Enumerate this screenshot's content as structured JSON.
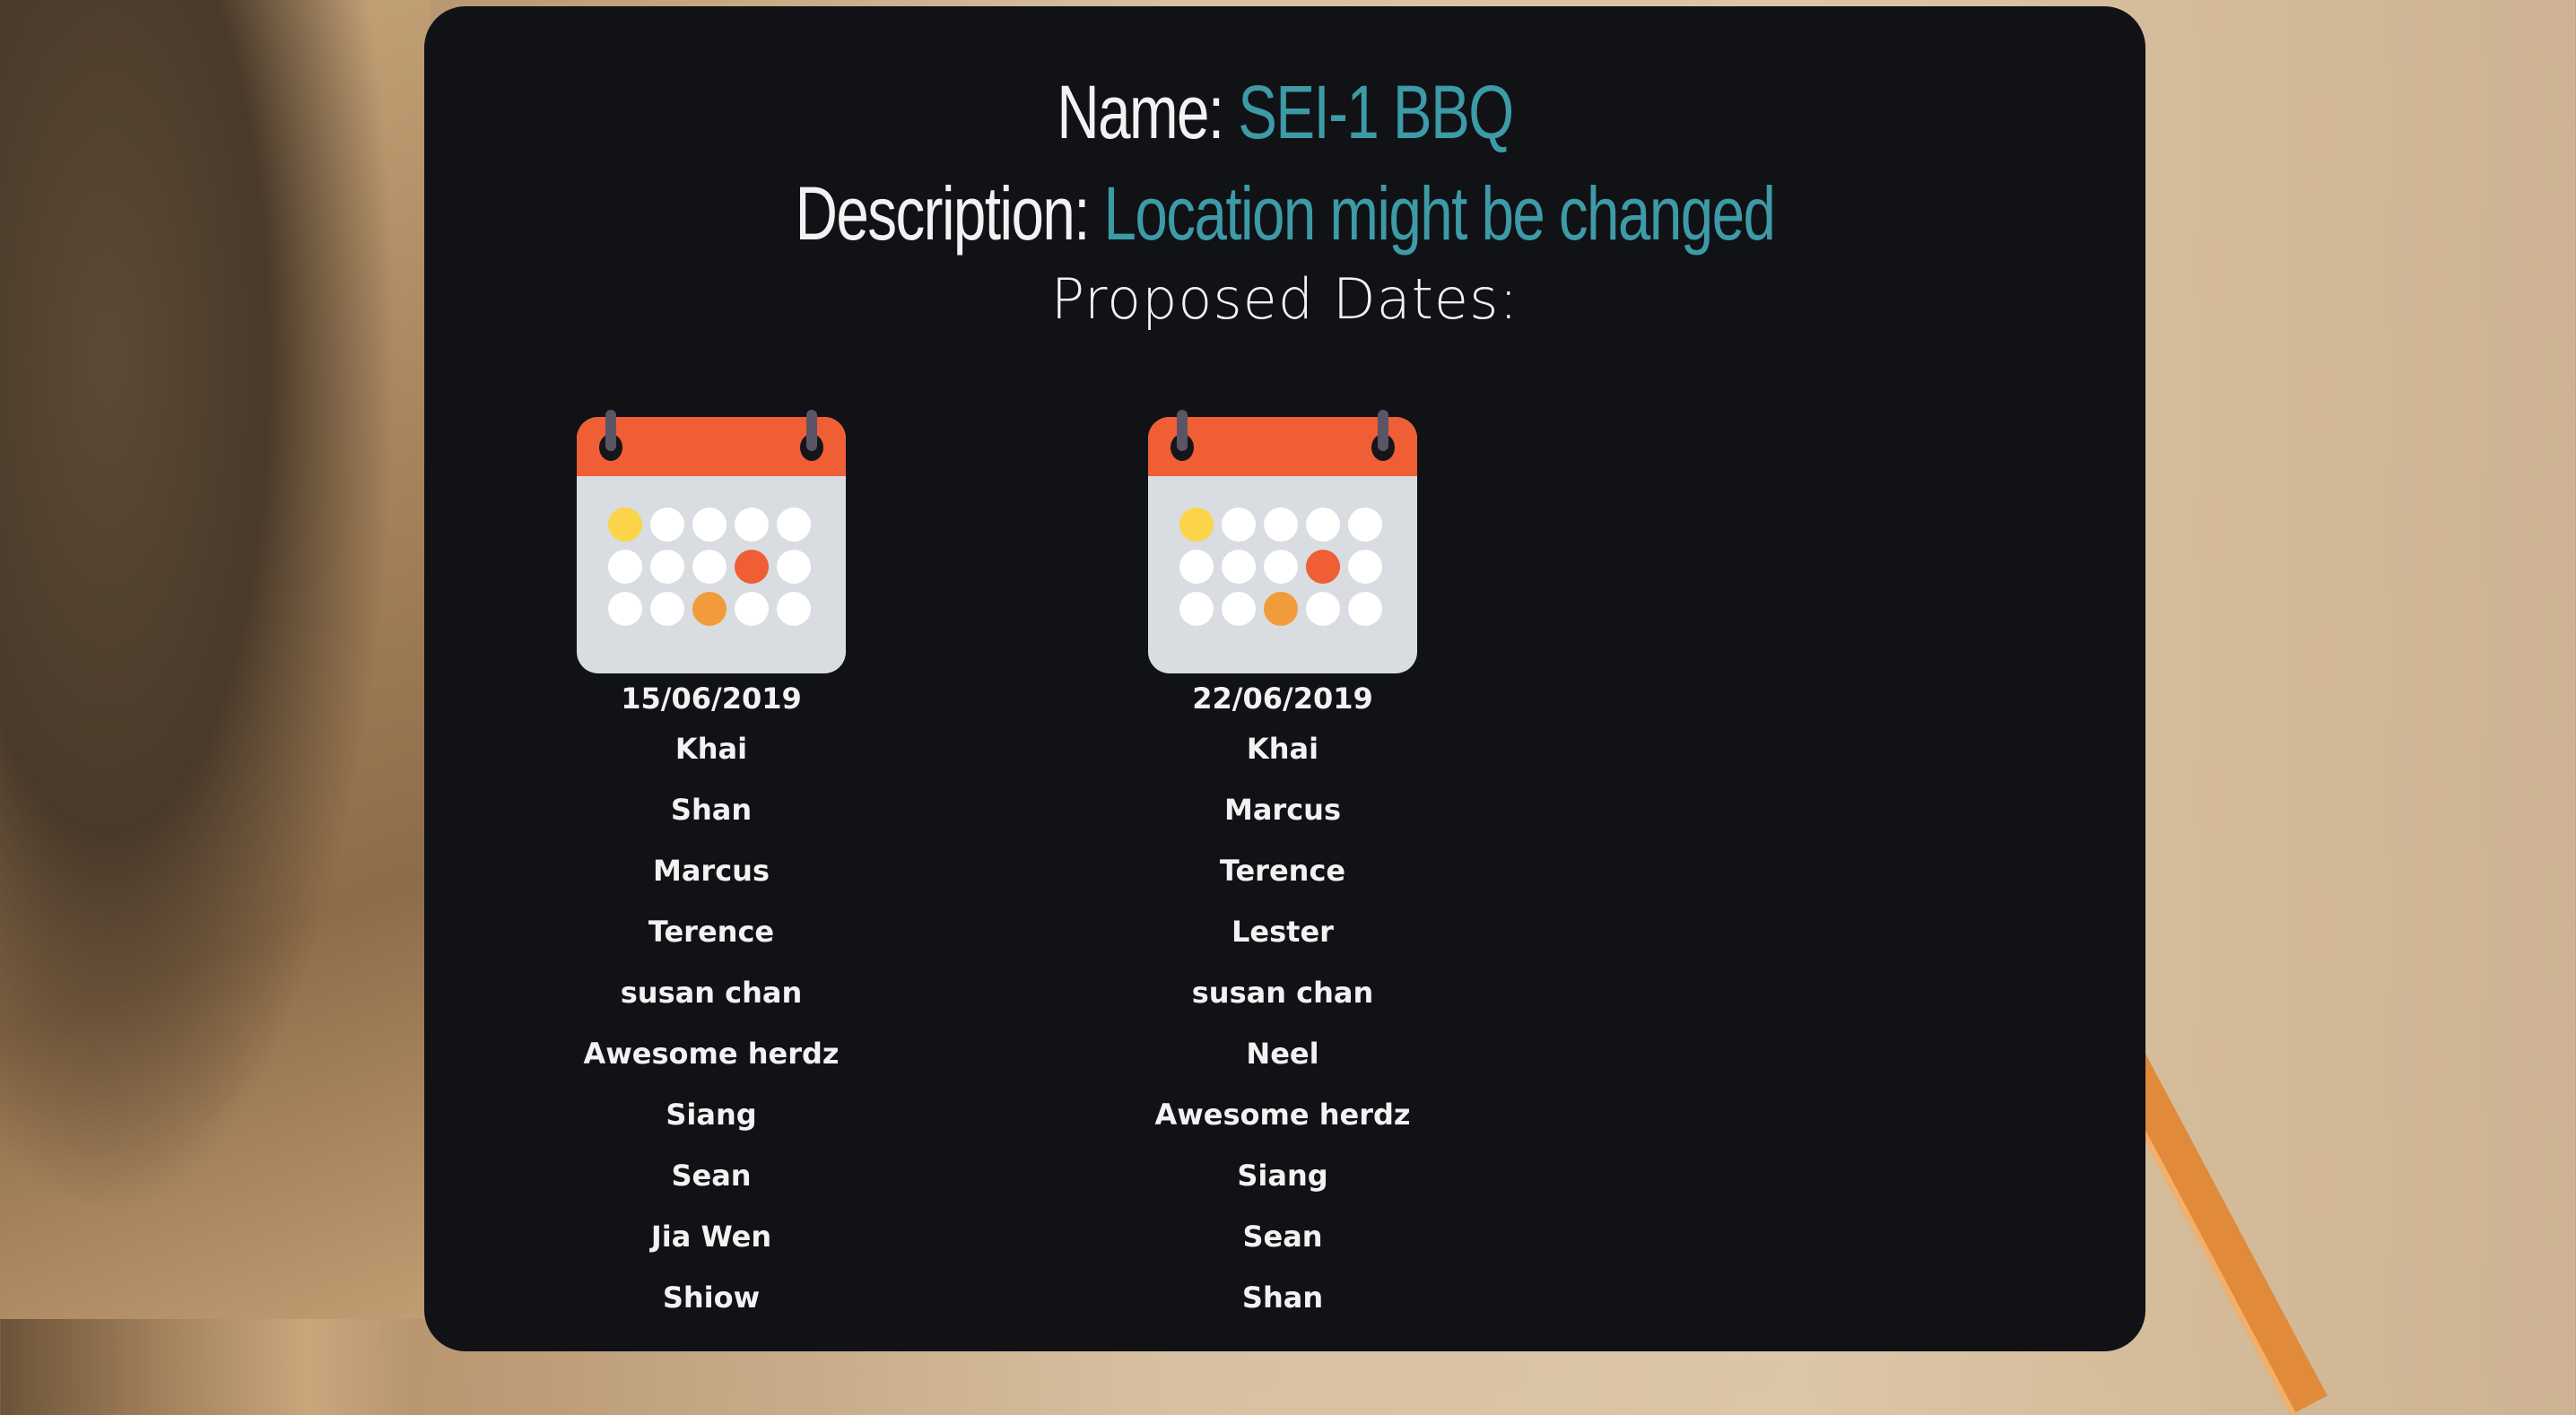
{
  "event": {
    "name_label": "Name:",
    "name_value": "SEI-1 BBQ",
    "description_label": "Description:",
    "description_value": "Location might be changed",
    "proposed_label": "Proposed Dates:"
  },
  "dates": [
    {
      "date": "15/06/2019",
      "people": [
        "Khai",
        "Shan",
        "Marcus",
        "Terence",
        "susan chan",
        "Awesome herdz",
        "Siang",
        "Sean",
        "Jia Wen",
        "Shiow"
      ]
    },
    {
      "date": "22/06/2019",
      "people": [
        "Khai",
        "Marcus",
        "Terence",
        "Lester",
        "susan chan",
        "Neel",
        "Awesome herdz",
        "Siang",
        "Sean",
        "Shan"
      ]
    }
  ],
  "colors": {
    "accent": "#3d9aa6",
    "panel": "#101216",
    "calendar_top": "#ef5e35"
  }
}
